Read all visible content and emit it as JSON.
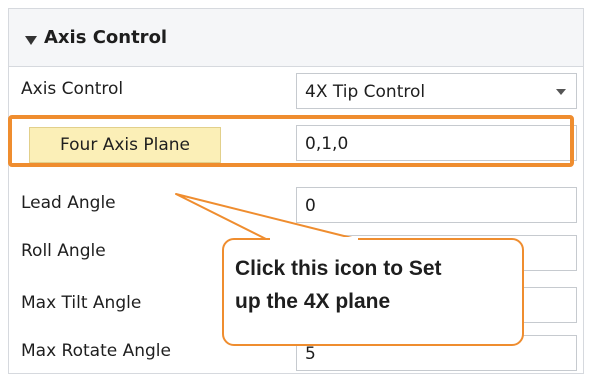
{
  "panel": {
    "title": "Axis Control",
    "rows": [
      {
        "label": "Axis Control",
        "value": "4X Tip Control"
      },
      {
        "label": "Four Axis Plane",
        "value": "0,1,0"
      },
      {
        "label": "Lead Angle",
        "value": "0"
      },
      {
        "label": "Roll Angle",
        "value": ""
      },
      {
        "label": "Max Tilt Angle",
        "value": ""
      },
      {
        "label": "Max Rotate Angle",
        "value": "5"
      }
    ]
  },
  "callout": {
    "line1": "Click this icon to Set",
    "line2": "up the 4X plane"
  },
  "colors": {
    "highlight": "#ef8d2f",
    "plane_button_bg": "#fbefb7",
    "header_bg": "#f5f6f8"
  }
}
